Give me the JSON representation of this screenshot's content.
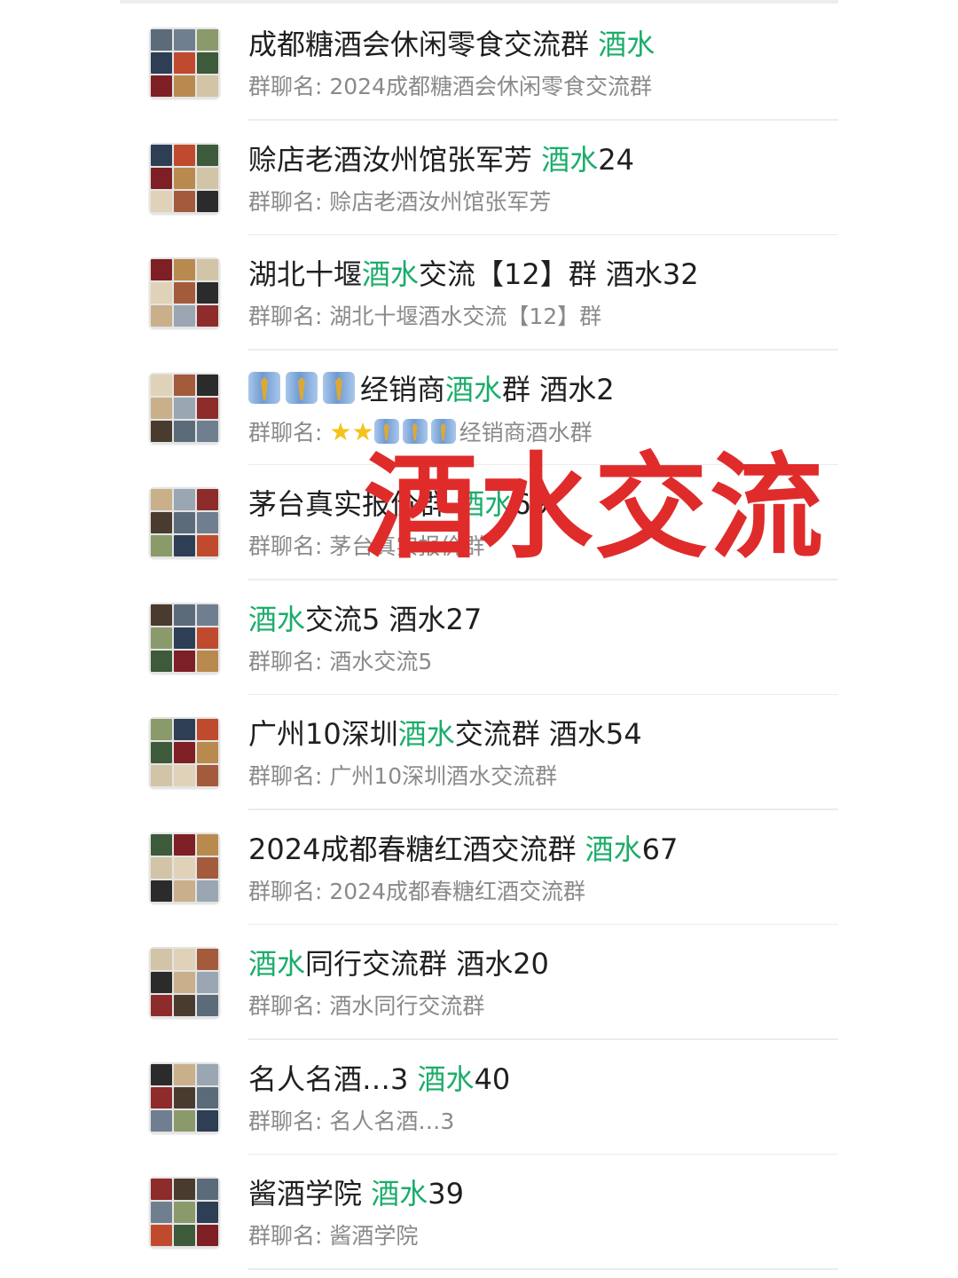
{
  "overlay_text": "酒水交流",
  "colors": {
    "keyword": "#1aad6a",
    "overlay": "#e02b2b",
    "subtitle": "#8a8a8a"
  },
  "groups": [
    {
      "pre": "成都糖酒会休闲零食交流群  ",
      "kw": "酒水",
      "post": "",
      "sub": "群聊名: 2024成都糖酒会休闲零食交流群"
    },
    {
      "pre": "赊店老酒汝州馆张军芳 ",
      "kw": "酒水",
      "post": "24",
      "sub": "群聊名: 赊店老酒汝州馆张军芳"
    },
    {
      "pre": "湖北十堰",
      "kw": "酒水",
      "post": "交流【12】群 酒水32",
      "sub": "群聊名: 湖北十堰酒水交流【12】群"
    },
    {
      "pre": "经销商",
      "kw": "酒水",
      "post": "群 酒水2",
      "sub_pre": "群聊名: ",
      "sub_post": "经销商酒水群",
      "title_icon": "necktie-emoji-icon",
      "sub_icons": [
        "star-emoji-icon",
        "necktie-emoji-icon"
      ]
    },
    {
      "pre": "茅台真实报价群 ",
      "kw": "酒水",
      "post": "69",
      "sub": "群聊名: 茅台真实报价群"
    },
    {
      "pre": "",
      "kw": "酒水",
      "post": "交流5 酒水27",
      "sub": "群聊名: 酒水交流5"
    },
    {
      "pre": "广州10深圳",
      "kw": "酒水",
      "post": "交流群  酒水54",
      "sub": "群聊名: 广州10深圳酒水交流群"
    },
    {
      "pre": "2024成都春糖红酒交流群 ",
      "kw": "酒水",
      "post": "67",
      "sub": "群聊名: 2024成都春糖红酒交流群"
    },
    {
      "pre": "",
      "kw": "酒水",
      "post": "同行交流群 酒水20",
      "sub": "群聊名: 酒水同行交流群"
    },
    {
      "pre": "名人名酒…3 ",
      "kw": "酒水",
      "post": "40",
      "sub": "群聊名: 名人名酒…3"
    },
    {
      "pre": "酱酒学院 ",
      "kw": "酒水",
      "post": "39",
      "sub": "群聊名: 酱酒学院"
    }
  ]
}
